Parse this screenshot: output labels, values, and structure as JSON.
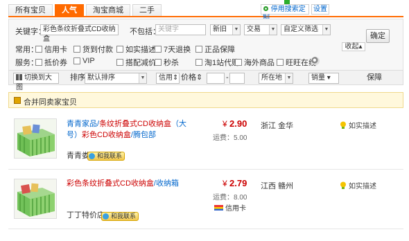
{
  "tabs": [
    {
      "label": "所有宝贝",
      "active": false
    },
    {
      "label": "人气",
      "active": true
    },
    {
      "label": "淘宝商城",
      "active": false
    },
    {
      "label": "二手",
      "active": false
    }
  ],
  "header_actions": {
    "custom_search": "停用搜索定制",
    "settings": "设置"
  },
  "filters": {
    "keyword_label": "关键字：",
    "keyword_value": "彩色条纹折叠式CD收纳盒",
    "exclude_label": "不包括：",
    "exclude_placeholder": "关键字",
    "selects": [
      "新旧",
      "交易",
      "自定义筛选"
    ],
    "confirm_label": "确定",
    "common_label": "常用：",
    "common_options": [
      "信用卡",
      "货到付款",
      "如实描述",
      "7天退换",
      "正品保障"
    ],
    "fold_label": "收起",
    "service_label": "服务：",
    "service_options": [
      "抵价券",
      "VIP",
      "搭配减价",
      "秒杀",
      "淘1站代购",
      "海外商品",
      "旺旺在线"
    ]
  },
  "sortbar": {
    "view_toggle": "切换到大图",
    "sort_label": "排序",
    "sort_value": "默认排序",
    "credit": "信用",
    "price": "价格",
    "price_sep": "-",
    "location": "所在地",
    "sales": "销量",
    "guarantee": "保障"
  },
  "merge_label": "合并同卖家宝贝",
  "items": [
    {
      "title_pre": "青青家品/",
      "title_hl": "条纹折叠式CD收纳盒",
      "title_mid": "（大号）",
      "title_hl2": "彩色CD收纳盒",
      "title_post": "/腾包部",
      "price_symbol": "¥",
      "price": "2.90",
      "shipping": "运费：5.00",
      "location": "浙江 金华",
      "description": "如实描述",
      "seller": "青青娄",
      "contact": "和我联系"
    },
    {
      "title_hl": "彩色条纹折叠式CD收纳盒",
      "title_post": "/收纳箱",
      "price_symbol": "¥",
      "price": "2.79",
      "shipping": "运费：8.00",
      "location": "江西 赣州",
      "description": "如实描述",
      "card": "信用卡",
      "seller": "丁丁特价店",
      "contact": "和我联系"
    }
  ],
  "colors": {
    "accent": "#ff6a00",
    "price": "#cc0000",
    "link": "#0066cc",
    "merge_bg": "#fff8dc"
  }
}
